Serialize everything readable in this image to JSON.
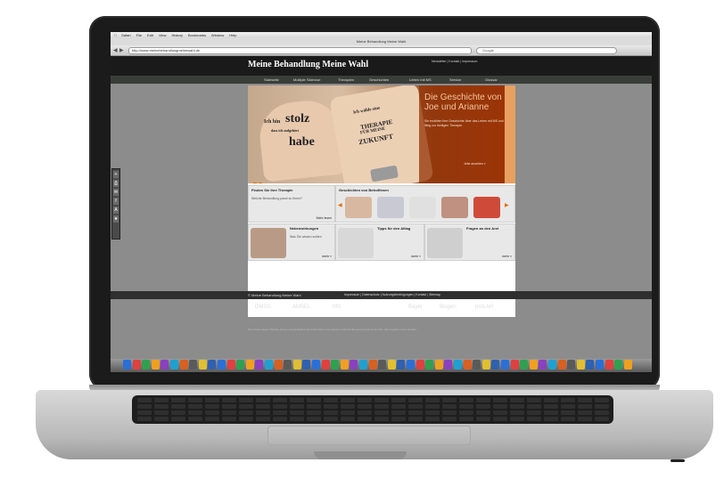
{
  "browser": {
    "app_menu": [
      "Safari",
      "File",
      "Edit",
      "View",
      "History",
      "Bookmarks",
      "Window",
      "Help"
    ],
    "window_title": "Meine Behandlung Meine Wahl",
    "url": "http://www.meinebehandlungmeinewahl.de",
    "search_placeholder": "Google"
  },
  "site": {
    "title": "Meine Behandlung Meine Wahl",
    "header_links": "Newsletter | Kontakt | Impressum",
    "nav": [
      "Startseite",
      "Multiple Sklerose",
      "Therapien",
      "Geschichten",
      "Leben mit MS",
      "Service",
      "Glossar"
    ],
    "hero": {
      "title": "Die Geschichte von Joe und Arianne",
      "text": "Sie erzählen ihre Geschichte über das Leben mit MS und den Weg zur richtigen Therapie.",
      "more": "Jetzt ansehen »",
      "tattoo_left_1": "Ich bin",
      "tattoo_left_2": "stolz",
      "tattoo_left_3": "dass ich aufgehört",
      "tattoo_left_4": "habe",
      "tattoo_right_1": "Ich wähle eine",
      "tattoo_right_2": "THERAPIE",
      "tattoo_right_3": "FÜR MEINE",
      "tattoo_right_4": "ZUKUNFT"
    },
    "boxes": [
      {
        "title": "Finden Sie Ihre Therapie",
        "text": "Welche Behandlung passt zu Ihnen?",
        "link": "Mehr lesen"
      },
      {
        "title": "Geschichten von Betroffenen",
        "text": "",
        "link": ""
      },
      {
        "title": "Nebenwirkungen",
        "text": "Was Sie wissen sollten",
        "link": "mehr »"
      },
      {
        "title": "Tipps für den Alltag",
        "text": "",
        "link": "mehr »"
      },
      {
        "title": "Fragen an den Arzt",
        "text": "",
        "link": "mehr »"
      }
    ],
    "footer_left": "© Meine Behandlung Meine Wahl",
    "footer_right": "Impressum | Datenschutz | Nutzungsbedingungen | Kontakt | Sitemap",
    "logos": [
      "DMSG",
      "AMSEL",
      "MS",
      "Bayer",
      "Biogen",
      "proLAR"
    ],
    "disclaimer": "Die Inhalte dieser Website dienen ausschließlich der Information und ersetzen nicht die Beratung durch einen Arzt. Alle Angaben ohne Gewähr."
  },
  "colors": {
    "accent": "#e07000",
    "header": "#1a1a1a",
    "nav": "#3a3e3a",
    "page_bg": "#8c8c8c"
  },
  "icons": [
    "apple-icon",
    "back-icon",
    "forward-icon",
    "search-icon",
    "dock-icons"
  ]
}
